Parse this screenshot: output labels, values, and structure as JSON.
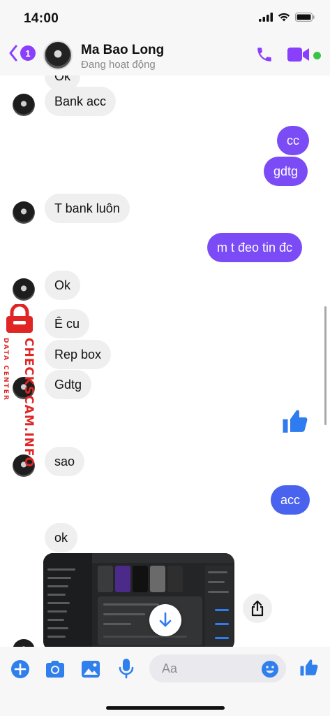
{
  "status_bar": {
    "time": "14:00"
  },
  "header": {
    "unread_count": "1",
    "contact_name": "Ma Bao Long",
    "contact_status": "Đang hoạt động"
  },
  "messages": [
    {
      "from": "them",
      "text": "Ok"
    },
    {
      "from": "them",
      "text": "Bank acc"
    },
    {
      "from": "me",
      "text": "cc"
    },
    {
      "from": "me",
      "text": "gdtg"
    },
    {
      "from": "them",
      "text": "T bank luôn"
    },
    {
      "from": "me",
      "text": "m t đeo tin đc"
    },
    {
      "from": "them",
      "text": "Ok"
    },
    {
      "from": "them",
      "text": "Ê cu"
    },
    {
      "from": "them",
      "text": "Rep box"
    },
    {
      "from": "them",
      "text": "Gdtg"
    },
    {
      "from": "me",
      "type": "like-sticker"
    },
    {
      "from": "them",
      "text": "sao"
    },
    {
      "from": "me",
      "text": "acc"
    },
    {
      "from": "them",
      "text": "ok"
    },
    {
      "from": "them",
      "type": "image-screenshot"
    }
  ],
  "watermark": {
    "main": "CHECKSCAM.INFO",
    "sub": "DATA CENTER"
  },
  "composer": {
    "placeholder": "Aa"
  },
  "colors": {
    "accent_purple": "#7b4cf5",
    "accent_blue": "#4a63ee",
    "incoming_bubble": "#efefef",
    "online": "#3ac34a",
    "icon_blue": "#2f80ed",
    "watermark_red": "#e02525"
  },
  "icons": [
    "back-chevron-icon",
    "phone-icon",
    "video-camera-icon",
    "thumbs-up-icon",
    "download-arrow-icon",
    "share-icon",
    "plus-circle-icon",
    "camera-icon",
    "photo-icon",
    "microphone-icon",
    "emoji-icon",
    "padlock-icon"
  ]
}
